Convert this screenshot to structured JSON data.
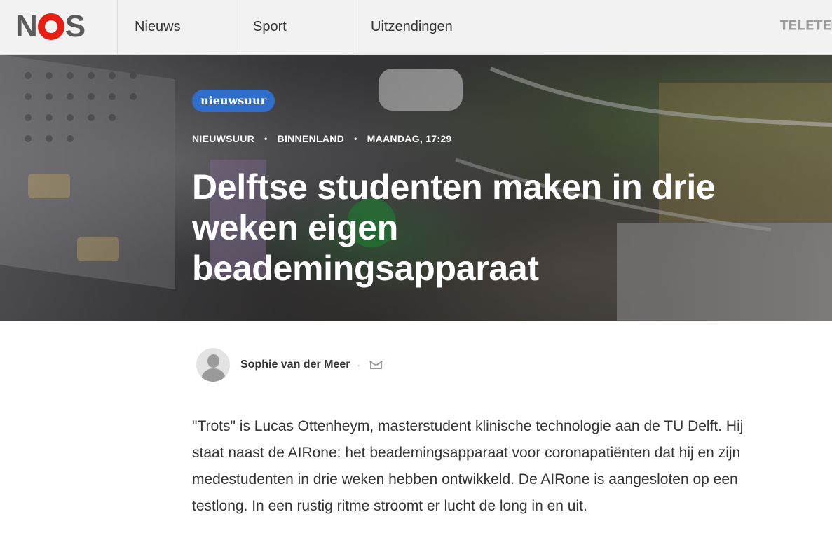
{
  "brand": {
    "logo_text_left": "N",
    "logo_text_right": "S"
  },
  "nav": {
    "items": [
      {
        "label": "Nieuws"
      },
      {
        "label": "Sport"
      },
      {
        "label": "Uitzendingen"
      }
    ],
    "teletekst_label": "TELETEKST"
  },
  "hero": {
    "badge": "nieuwsuur",
    "meta": [
      "NIEUWSUUR",
      "BINNENLAND",
      "MAANDAG, 17:29"
    ],
    "meta_separator": "•",
    "headline": "Delftse studenten maken in drie weken eigen beademingsapparaat"
  },
  "author": {
    "name": "Sophie van der Meer",
    "separator": "·",
    "mail_icon": "mail-icon"
  },
  "article": {
    "paragraph_1": "\"Trots\" is Lucas Ottenheym, masterstudent klinische technologie aan de TU Delft. Hij staat naast de AIRone: het beademingsapparaat voor coronapatiënten dat hij en zijn medestudenten in drie weken hebben ontwikkeld. De AIRone is aangesloten op een testlong. In een rustig ritme stroomt er lucht de long in en uit."
  },
  "colors": {
    "logo_o": "#e61e14",
    "badge": "#2f6fcb",
    "nav_bg": "#f2f2f2"
  }
}
